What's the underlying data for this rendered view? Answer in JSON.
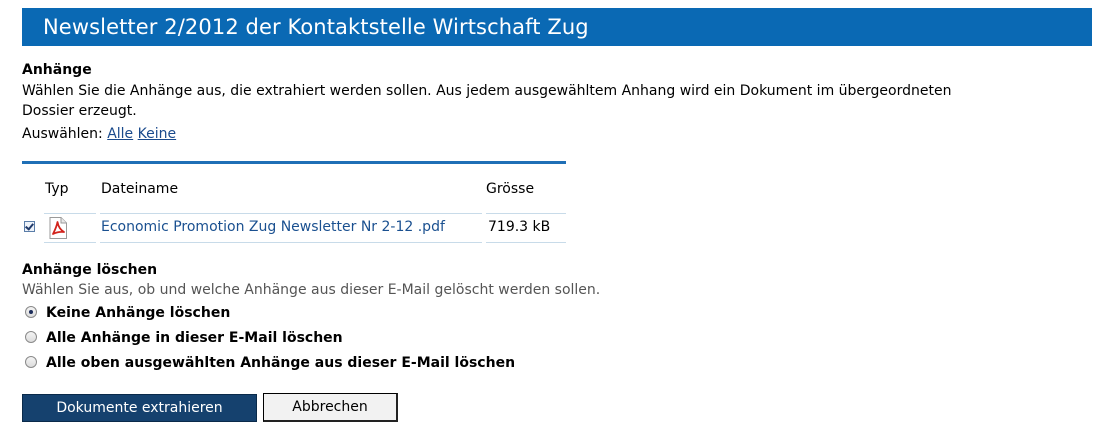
{
  "title": "Newsletter 2/2012 der Kontaktstelle Wirtschaft Zug",
  "attachments": {
    "heading": "Anhänge",
    "description_line1": "Wählen Sie die Anhänge aus, die extrahiert werden sollen. Aus jedem ausgewähltem Anhang wird ein Dokument im übergeordneten",
    "description_line2": "Dossier erzeugt.",
    "select_label": "Auswählen:",
    "select_all": "Alle",
    "select_none": "Keine"
  },
  "table": {
    "columns": [
      "Typ",
      "Dateiname",
      "Grösse"
    ],
    "rows": [
      {
        "checked": true,
        "type_icon": "pdf-icon",
        "filename": "Economic Promotion Zug Newsletter Nr 2-12 .pdf",
        "size": "719.3 kB"
      }
    ]
  },
  "delete": {
    "heading": "Anhänge löschen",
    "description": "Wählen Sie aus, ob und welche Anhänge aus dieser E-Mail gelöscht werden sollen.",
    "options": [
      {
        "label": "Keine Anhänge löschen",
        "selected": true
      },
      {
        "label": "Alle Anhänge in dieser E-Mail löschen",
        "selected": false
      },
      {
        "label": "Alle oben ausgewählten Anhänge aus dieser E-Mail löschen",
        "selected": false
      }
    ]
  },
  "buttons": {
    "extract": "Dokumente extrahieren",
    "cancel": "Abbrechen"
  },
  "colors": {
    "title_bar": "#0a69b4",
    "primary_button": "#15416e",
    "link": "#1a4a8c"
  }
}
